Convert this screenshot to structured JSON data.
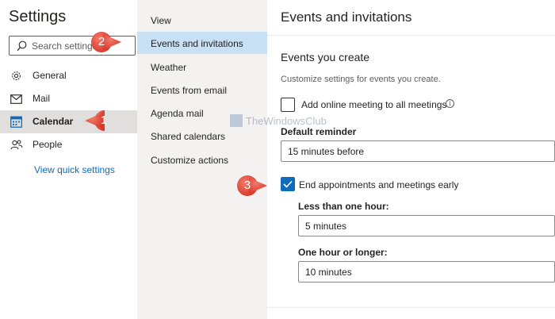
{
  "settings": {
    "title": "Settings",
    "search": {
      "placeholder": "Search settings"
    },
    "nav": [
      {
        "label": "General",
        "icon": "gear-icon"
      },
      {
        "label": "Mail",
        "icon": "mail-icon"
      },
      {
        "label": "Calendar",
        "icon": "calendar-icon",
        "selected": true
      },
      {
        "label": "People",
        "icon": "people-icon"
      }
    ],
    "quick_settings_label": "View quick settings"
  },
  "calendar_nav": {
    "items": [
      {
        "label": "View"
      },
      {
        "label": "Events and invitations",
        "selected": true
      },
      {
        "label": "Weather"
      },
      {
        "label": "Events from email"
      },
      {
        "label": "Agenda mail"
      },
      {
        "label": "Shared calendars"
      },
      {
        "label": "Customize actions"
      }
    ]
  },
  "content": {
    "title": "Events and invitations",
    "section_title": "Events you create",
    "section_desc": "Customize settings for events you create.",
    "online_meeting": {
      "label": "Add online meeting to all meetings",
      "checked": false
    },
    "default_reminder": {
      "label": "Default reminder",
      "value": "15 minutes before"
    },
    "end_early": {
      "label": "End appointments and meetings early",
      "checked": true
    },
    "less_than_hour": {
      "label": "Less than one hour:",
      "value": "5 minutes"
    },
    "hour_or_longer": {
      "label": "One hour or longer:",
      "value": "10 minutes"
    }
  },
  "watermark": {
    "text": "TheWindowsClub"
  },
  "markers": [
    {
      "number": "1"
    },
    {
      "number": "2"
    },
    {
      "number": "3"
    }
  ],
  "colors": {
    "accent": "#0f6cbd",
    "selected_nav": "#e1dfdd",
    "selected_subnav": "#c7e0f4",
    "marker": "#e8463a"
  }
}
